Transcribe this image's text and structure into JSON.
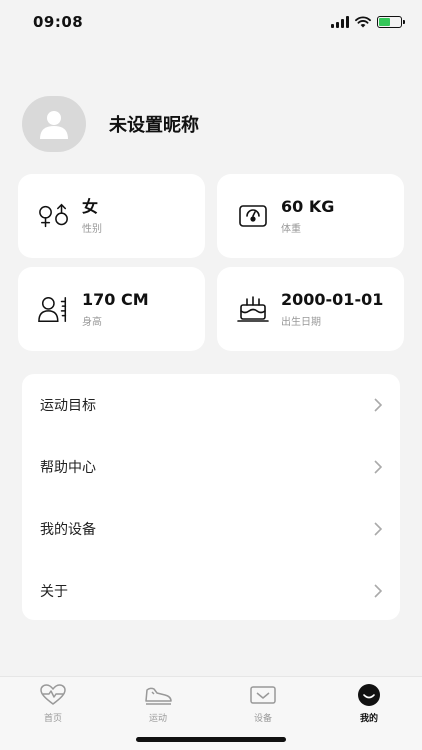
{
  "status_bar": {
    "time": "09:08"
  },
  "profile": {
    "nickname": "未设置昵称"
  },
  "cards": {
    "gender": {
      "value": "女",
      "label": "性别",
      "icon": "gender-icon"
    },
    "weight": {
      "value": "60 KG",
      "label": "体重",
      "icon": "scale-icon"
    },
    "height": {
      "value": "170 CM",
      "label": "身高",
      "icon": "height-icon"
    },
    "birthday": {
      "value": "2000-01-01",
      "label": "出生日期",
      "icon": "cake-icon"
    }
  },
  "menu": {
    "items": [
      {
        "label": "运动目标",
        "icon": "chevron-right-icon"
      },
      {
        "label": "帮助中心",
        "icon": "chevron-right-icon"
      },
      {
        "label": "我的设备",
        "icon": "chevron-right-icon"
      },
      {
        "label": "关于",
        "icon": "chevron-right-icon"
      }
    ]
  },
  "tabs": {
    "items": [
      {
        "label": "首页",
        "icon": "heart-pulse-icon"
      },
      {
        "label": "运动",
        "icon": "shoe-icon"
      },
      {
        "label": "设备",
        "icon": "device-icon"
      },
      {
        "label": "我的",
        "icon": "profile-face-icon"
      }
    ],
    "active": "我的"
  },
  "colors": {
    "background": "#f3f3f3",
    "card": "#ffffff",
    "battery": "#34c759",
    "muted": "#999999"
  }
}
